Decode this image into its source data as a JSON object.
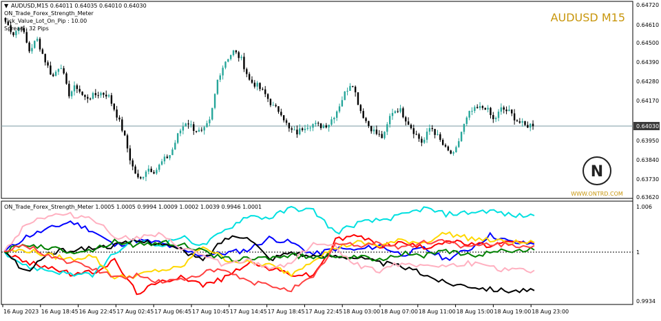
{
  "header": {
    "symbol_line": "AUDUSD,M15  0.64011 0.64035 0.64010 0.64030",
    "indicator_name": "ON_Trade_Forex_Strength_Meter",
    "tick_value": "Tick_Value_Lot_On_Pip : 10.00",
    "spread": "Spread : 32  Pips",
    "symbol_title": "AUDUSD M15"
  },
  "watermark": {
    "site": "WWW.ONTRD.COM",
    "logo_text": "N"
  },
  "price_axis": {
    "labels": [
      "0.64720",
      "0.64610",
      "0.64500",
      "0.64390",
      "0.64280",
      "0.64170",
      "0.64030",
      "0.63950",
      "0.63840",
      "0.63730",
      "0.63620"
    ],
    "current_price": "0.64030"
  },
  "indicator": {
    "header": "ON_Trade_Forex_Strength_Meter 1.0005 1.0005 0.9994 1.0009 1.0002 1.0039 0.9946 1.0001",
    "axis_labels": [
      "1.006",
      "1",
      "0.9934"
    ]
  },
  "time_axis": {
    "labels": [
      "16 Aug 2023",
      "16 Aug 18:45",
      "16 Aug 22:45",
      "17 Aug 02:45",
      "17 Aug 06:45",
      "17 Aug 10:45",
      "17 Aug 14:45",
      "17 Aug 18:45",
      "17 Aug 22:45",
      "18 Aug 03:00",
      "18 Aug 07:00",
      "18 Aug 11:00",
      "18 Aug 15:00",
      "18 Aug 19:00",
      "18 Aug 23:00"
    ]
  },
  "chart_data": [
    {
      "type": "candlestick",
      "title": "AUDUSD M15",
      "ylim": [
        0.6362,
        0.6472
      ],
      "current_price": 0.6403,
      "close_path": [
        0.6462,
        0.6455,
        0.646,
        0.6445,
        0.6452,
        0.644,
        0.643,
        0.6438,
        0.642,
        0.6425,
        0.6418,
        0.6419,
        0.6421,
        0.642,
        0.641,
        0.6398,
        0.638,
        0.637,
        0.6378,
        0.6376,
        0.6382,
        0.6386,
        0.6398,
        0.6405,
        0.64,
        0.6398,
        0.6405,
        0.643,
        0.644,
        0.6445,
        0.644,
        0.6428,
        0.6425,
        0.642,
        0.6413,
        0.641,
        0.64,
        0.6398,
        0.6402,
        0.6403,
        0.6402,
        0.6403,
        0.641,
        0.642,
        0.6428,
        0.6412,
        0.6403,
        0.6398,
        0.6395,
        0.641,
        0.6412,
        0.6405,
        0.6398,
        0.6392,
        0.6402,
        0.6395,
        0.6388,
        0.6385,
        0.64,
        0.641,
        0.6412,
        0.6413,
        0.6405,
        0.6412,
        0.641,
        0.6405,
        0.6402,
        0.6403
      ]
    },
    {
      "type": "line",
      "title": "ON_Trade_Forex_Strength_Meter",
      "ylim": [
        0.9934,
        1.006
      ],
      "reference_level": 1,
      "series": [
        {
          "color": "#0000ff",
          "values": [
            1.0,
            1.002,
            1.003,
            1.004,
            1.0028,
            1.0008,
            1.0015,
            1.0012,
            1.0002,
            0.9995,
            0.9998,
            1.0002,
            1.0018,
            1.0012,
            0.9996,
            1.0004,
            1.0002,
            1.0008,
            0.9996,
            1.0004,
            0.999,
            1.0002,
            1.0022,
            1.0012,
            1.001
          ]
        },
        {
          "color": "#ff0000",
          "values": [
            1.0,
            0.9985,
            0.998,
            0.997,
            0.9972,
            0.9988,
            0.9945,
            0.9958,
            0.9968,
            0.9955,
            0.9965,
            0.9985,
            0.9978,
            0.997,
            0.9968,
            1.0015,
            1.0022,
            1.0008,
            1.0012,
            1.0005,
            1.0015,
            1.001,
            1.0008,
            1.0012,
            1.0012
          ]
        },
        {
          "color": "#00e0e0",
          "values": [
            1.0,
            0.998,
            0.9975,
            0.997,
            0.9968,
            0.9998,
            1.0015,
            1.0008,
            1.002,
            1.0008,
            1.0028,
            1.0048,
            1.0045,
            1.0058,
            1.0055,
            1.0025,
            1.0038,
            1.0042,
            1.0048,
            1.0058,
            1.005,
            1.0052,
            1.0055,
            1.0048,
            1.0048
          ]
        },
        {
          "color": "#000000",
          "values": [
            1.0,
            0.9972,
            0.9998,
            1.0002,
            1.0005,
            1.0008,
            1.0014,
            1.0012,
            1.0002,
            0.9988,
            1.0018,
            1.0022,
            0.999,
            1.0,
            0.9992,
            0.9995,
            0.9992,
            0.9985,
            0.998,
            0.997,
            0.9958,
            0.9955,
            0.995,
            0.9948,
            0.9948
          ]
        },
        {
          "color": "#ffd800",
          "values": [
            1.0,
            1.0002,
            0.9995,
            0.999,
            0.9995,
            0.9965,
            0.9968,
            0.9975,
            0.9978,
            1.0008,
            0.999,
            0.9985,
            0.9982,
            0.997,
            0.999,
            1.0005,
            1.0012,
            1.0008,
            1.0015,
            1.0012,
            1.0025,
            1.0018,
            1.0015,
            1.0012,
            1.0012
          ]
        },
        {
          "color": "#008000",
          "values": [
            1.0,
            1.001,
            1.0005,
            1.0,
            1.0002,
            1.0014,
            1.0008,
            1.0012,
            1.001,
            1.0,
            0.999,
            0.999,
            0.9992,
            0.9995,
            0.9992,
            0.9995,
            0.9992,
            0.999,
            0.9998,
            0.9995,
            1.0,
            0.9995,
            0.9998,
            1.0002,
            1.0002
          ]
        },
        {
          "color": "#ffb0c0",
          "values": [
            1.0,
            1.0038,
            1.0048,
            1.0049,
            1.0045,
            1.002,
            1.0018,
            1.0022,
            1.0005,
            0.9995,
            0.9982,
            0.9988,
            0.9978,
            0.9985,
            1.0012,
            1.0005,
            0.9982,
            0.9975,
            0.9985,
            0.9982,
            0.998,
            0.9985,
            0.9978,
            0.9975,
            0.9975
          ]
        },
        {
          "color": "#ff4040",
          "values": [
            1.0,
            1.0008,
            0.9995,
            0.9985,
            0.9978,
            0.9965,
            0.9968,
            0.996,
            0.9962,
            0.9972,
            0.9975,
            0.996,
            0.9955,
            0.995,
            0.9965,
            1.001,
            1.0008,
            1.0012,
            1.0005,
            1.0012,
            1.0015,
            1.0005,
            1.001,
            1.0008,
            1.0008
          ]
        }
      ]
    }
  ]
}
